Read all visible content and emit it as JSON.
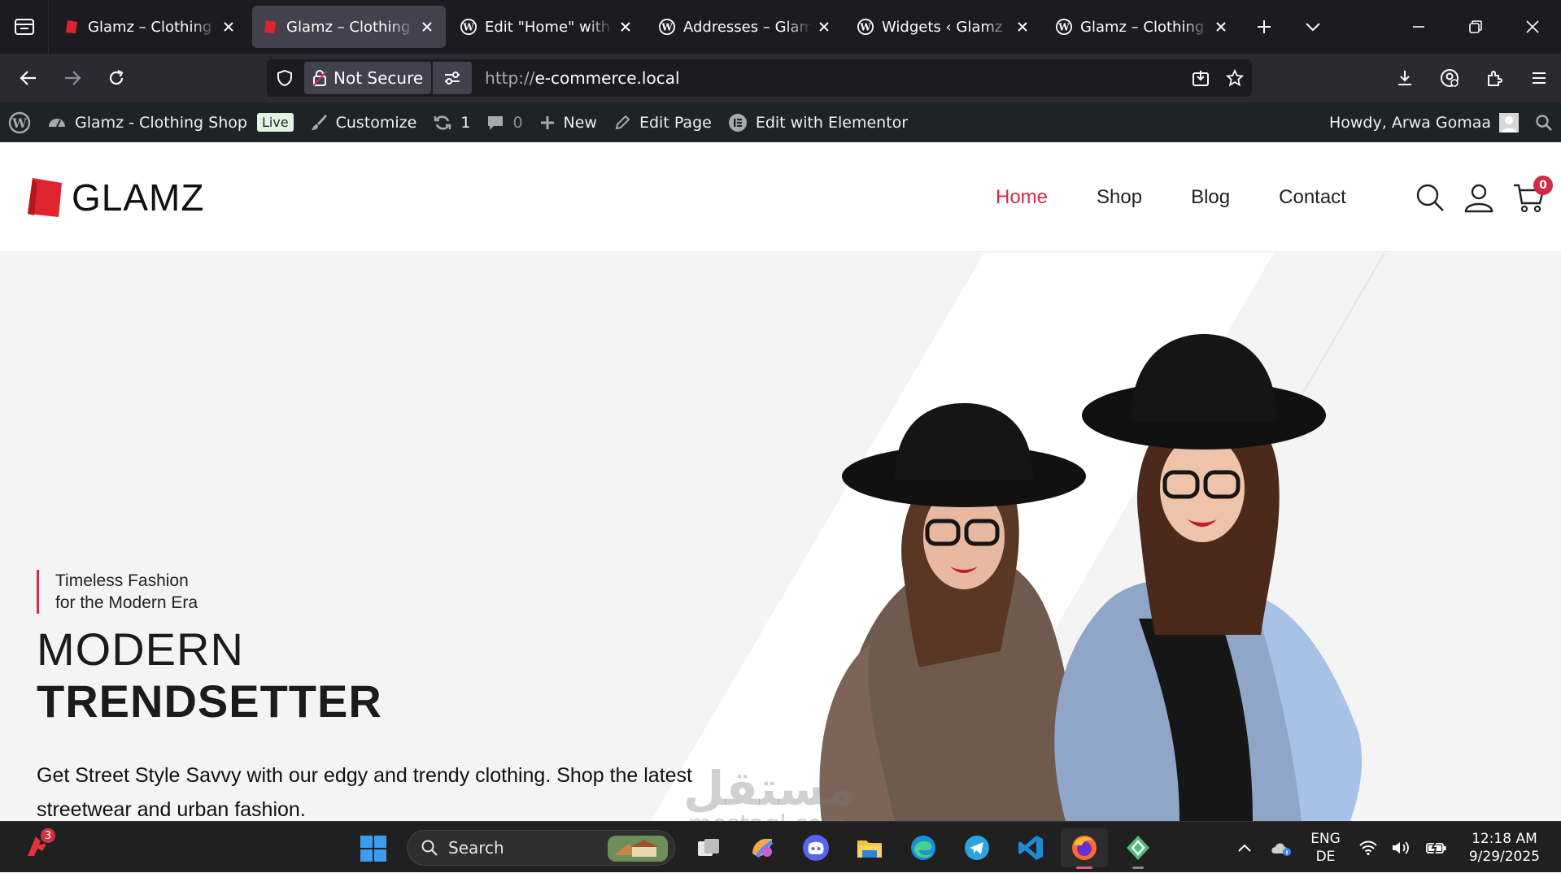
{
  "browser": {
    "tabs": [
      {
        "title": "Glamz – Clothing Shop",
        "favicon": "glamz-logo-icon",
        "active": false
      },
      {
        "title": "Glamz – Clothing Shop",
        "favicon": "glamz-logo-icon",
        "active": true
      },
      {
        "title": "Edit \"Home\" with Elementor",
        "favicon": "wordpress-icon",
        "active": false
      },
      {
        "title": "Addresses – Glamz",
        "favicon": "wordpress-icon",
        "active": false
      },
      {
        "title": "Widgets ‹ Glamz - Clothing Shop",
        "favicon": "wordpress-icon",
        "active": false
      },
      {
        "title": "Glamz – Clothing Shop",
        "favicon": "wordpress-icon",
        "active": false
      }
    ],
    "security_label": "Not Secure",
    "url_scheme": "http://",
    "url_host": "e-commerce.local"
  },
  "admin_bar": {
    "site_name": "Glamz - Clothing Shop",
    "live_label": "Live",
    "customize_label": "Customize",
    "updates_count": "1",
    "comments_count": "0",
    "new_label": "New",
    "edit_page_label": "Edit Page",
    "elementor_label": "Edit with Elementor",
    "howdy": "Howdy, Arwa Gomaa"
  },
  "site": {
    "logo_text": "GLAMZ",
    "menu": [
      {
        "label": "Home",
        "current": true
      },
      {
        "label": "Shop",
        "current": false
      },
      {
        "label": "Blog",
        "current": false
      },
      {
        "label": "Contact",
        "current": false
      }
    ],
    "cart_count": "0",
    "accent_color": "#d42a47"
  },
  "hero": {
    "tagline_line1": "Timeless Fashion",
    "tagline_line2": "for the Modern Era",
    "headline_line1": "MODERN",
    "headline_line2": "TRENDSETTER",
    "description": "Get Street Style Savvy with our edgy and trendy clothing. Shop the latest streetwear and urban fashion."
  },
  "watermark": {
    "arabic": "مستقل",
    "latin": "mostaql.com"
  },
  "taskbar": {
    "notification_count": "3",
    "search_label": "Search",
    "lang_line1": "ENG",
    "lang_line2": "DE",
    "time": "12:18 AM",
    "date": "9/29/2025"
  }
}
